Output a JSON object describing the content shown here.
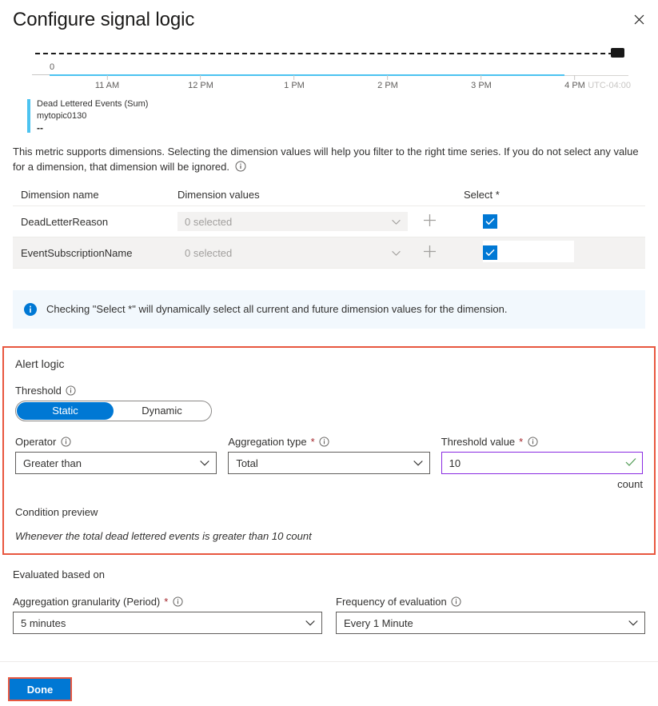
{
  "header": {
    "title": "Configure signal logic",
    "close_icon": "close-icon"
  },
  "chart": {
    "legend": {
      "series_name": "Dead Lettered Events (Sum)",
      "resource": "mytopic0130",
      "value": "--",
      "color": "#4cc3f0"
    },
    "timezone_label": "UTC-04:00",
    "y_zero_label": "0"
  },
  "chart_data": {
    "type": "line",
    "title": "Dead Lettered Events (Sum)",
    "subtitle": "mytopic0130",
    "xlabel": "",
    "ylabel": "",
    "x": [
      "11 AM",
      "12 PM",
      "1 PM",
      "2 PM",
      "3 PM",
      "4 PM"
    ],
    "tick_labels": [
      "11 AM",
      "12 PM",
      "1 PM",
      "2 PM",
      "3 PM",
      "4 PM"
    ],
    "timezone": "UTC-04:00",
    "series": [
      {
        "name": "Dead Lettered Events (Sum)",
        "values": [
          0,
          0,
          0,
          0,
          0,
          0
        ],
        "color": "#4cc3f0"
      }
    ],
    "threshold_line": {
      "value": 10,
      "style": "dashed",
      "color": "#1a1a1a",
      "label": ""
    },
    "ylim": [
      0,
      12
    ],
    "ytick_labels": [
      "0"
    ],
    "grid": false,
    "legend_position": "bottom-left",
    "current_value": "--"
  },
  "description": {
    "text": "This metric supports dimensions. Selecting the dimension values will help you filter to the right time series. If you do not select any value for a dimension, that dimension will be ignored.",
    "info_icon": "info-circle-icon"
  },
  "dimensions_table": {
    "columns": {
      "name": "Dimension name",
      "values": "Dimension values",
      "select": "Select",
      "select_required_marker": "*"
    },
    "rows": [
      {
        "name": "DeadLetterReason",
        "values_text": "0 selected",
        "add_icon": "plus-icon",
        "chevron_icon": "chevron-down-icon",
        "selected": true
      },
      {
        "name": "EventSubscriptionName",
        "values_text": "0 selected",
        "add_icon": "plus-icon",
        "chevron_icon": "chevron-down-icon",
        "selected": true
      }
    ]
  },
  "info_banner": {
    "icon": "info-filled-icon",
    "text": "Checking \"Select *\" will dynamically select all current and future dimension values for the dimension."
  },
  "alert_logic": {
    "section_title": "Alert logic",
    "threshold": {
      "label": "Threshold",
      "info_icon": "info-circle-icon",
      "options": [
        "Static",
        "Dynamic"
      ],
      "selected": "Static"
    },
    "operator": {
      "label": "Operator",
      "info_icon": "info-circle-icon",
      "value": "Greater than",
      "chevron_icon": "chevron-down-icon"
    },
    "aggregation_type": {
      "label": "Aggregation type",
      "required_marker": "*",
      "info_icon": "info-circle-icon",
      "value": "Total",
      "chevron_icon": "chevron-down-icon"
    },
    "threshold_value": {
      "label": "Threshold value",
      "required_marker": "*",
      "info_icon": "info-circle-icon",
      "value": "10",
      "unit": "count",
      "valid_icon": "checkmark-icon",
      "border_color": "#8a2be2"
    },
    "condition_preview": {
      "label": "Condition preview",
      "text": "Whenever the total dead lettered events is greater than 10 count"
    },
    "highlight_color": "#e8573f"
  },
  "evaluated_based_on": {
    "title": "Evaluated based on",
    "granularity": {
      "label": "Aggregation granularity (Period)",
      "required_marker": "*",
      "info_icon": "info-circle-icon",
      "value": "5 minutes",
      "chevron_icon": "chevron-down-icon"
    },
    "frequency": {
      "label": "Frequency of evaluation",
      "info_icon": "info-circle-icon",
      "value": "Every 1 Minute",
      "chevron_icon": "chevron-down-icon"
    }
  },
  "footer": {
    "done_label": "Done",
    "highlight_color": "#e8573f"
  }
}
